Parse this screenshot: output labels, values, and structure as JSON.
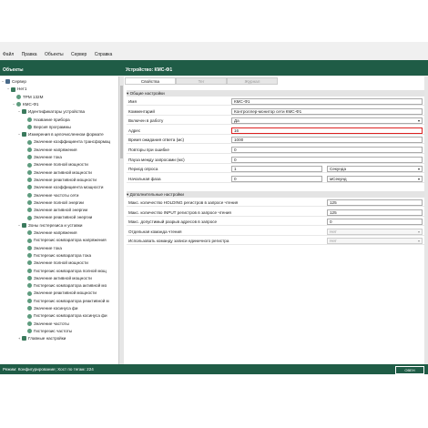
{
  "menu": [
    "Файл",
    "Правка",
    "Объекты",
    "Сервер",
    "Справка"
  ],
  "panels": {
    "left_title": "Объекты",
    "right_title": "Устройство: КМС-Ф1"
  },
  "tree": [
    {
      "label": "Сервер",
      "icon": "server-icon",
      "depth": 0,
      "expander": "−"
    },
    {
      "label": "Нет1",
      "icon": "folder-icon",
      "depth": 1,
      "expander": "−"
    },
    {
      "label": "ТРМ 132М",
      "icon": "device-icon",
      "depth": 2,
      "expander": ""
    },
    {
      "label": "КМС-Ф1",
      "icon": "device-icon",
      "depth": 2,
      "expander": "−"
    },
    {
      "label": "Идентификаторы устройства",
      "icon": "folder-icon",
      "depth": 3,
      "expander": "−"
    },
    {
      "label": "Название прибора",
      "icon": "param-icon",
      "depth": 4,
      "expander": ""
    },
    {
      "label": "Версия программы",
      "icon": "param-icon",
      "depth": 4,
      "expander": ""
    },
    {
      "label": "Измерения в целочисленном формате",
      "icon": "folder-icon",
      "depth": 3,
      "expander": "−"
    },
    {
      "label": "Значение коэффициента трансформац",
      "icon": "param-icon",
      "depth": 4,
      "expander": ""
    },
    {
      "label": "Значение напряжения",
      "icon": "param-icon",
      "depth": 4,
      "expander": ""
    },
    {
      "label": "Значение тока",
      "icon": "param-icon",
      "depth": 4,
      "expander": ""
    },
    {
      "label": "Значение полной мощности",
      "icon": "param-icon",
      "depth": 4,
      "expander": ""
    },
    {
      "label": "Значение активной мощности",
      "icon": "param-icon",
      "depth": 4,
      "expander": ""
    },
    {
      "label": "Значение реактивной мощности",
      "icon": "param-icon",
      "depth": 4,
      "expander": ""
    },
    {
      "label": "Значение коэффициента мощности",
      "icon": "param-icon",
      "depth": 4,
      "expander": ""
    },
    {
      "label": "Значение частоты сети",
      "icon": "param-icon",
      "depth": 4,
      "expander": ""
    },
    {
      "label": "Значение полной энергии",
      "icon": "param-icon",
      "depth": 4,
      "expander": ""
    },
    {
      "label": "Значение активной энергии",
      "icon": "param-icon",
      "depth": 4,
      "expander": ""
    },
    {
      "label": "Значение реактивной энергии",
      "icon": "param-icon",
      "depth": 4,
      "expander": ""
    },
    {
      "label": "Зоны гистерезиса и уставки",
      "icon": "folder-icon",
      "depth": 3,
      "expander": "−"
    },
    {
      "label": "Значение напряжения",
      "icon": "param-icon",
      "depth": 4,
      "expander": ""
    },
    {
      "label": "Гистерезис компаратора напряжения",
      "icon": "param-icon",
      "depth": 4,
      "expander": ""
    },
    {
      "label": "Значение тока",
      "icon": "param-icon",
      "depth": 4,
      "expander": ""
    },
    {
      "label": "Гистерезис компаратора тока",
      "icon": "param-icon",
      "depth": 4,
      "expander": ""
    },
    {
      "label": "Значение полной мощности",
      "icon": "param-icon",
      "depth": 4,
      "expander": ""
    },
    {
      "label": "Гистерезис компаратора полной мощ",
      "icon": "param-icon",
      "depth": 4,
      "expander": ""
    },
    {
      "label": "Значение активной мощности",
      "icon": "param-icon",
      "depth": 4,
      "expander": ""
    },
    {
      "label": "Гистерезис компаратора активной мо",
      "icon": "param-icon",
      "depth": 4,
      "expander": ""
    },
    {
      "label": "Значение реактивной мощности",
      "icon": "param-icon",
      "depth": 4,
      "expander": ""
    },
    {
      "label": "Гистерезис компаратора реактивной м",
      "icon": "param-icon",
      "depth": 4,
      "expander": ""
    },
    {
      "label": "Значение косинуса фи",
      "icon": "param-icon",
      "depth": 4,
      "expander": ""
    },
    {
      "label": "Гистерезис компаратора косинуса фи",
      "icon": "param-icon",
      "depth": 4,
      "expander": ""
    },
    {
      "label": "Значение частоты",
      "icon": "param-icon",
      "depth": 4,
      "expander": ""
    },
    {
      "label": "Гистерезис частоты",
      "icon": "param-icon",
      "depth": 4,
      "expander": ""
    },
    {
      "label": "Главные настройки",
      "icon": "folder-icon",
      "depth": 3,
      "expander": "+"
    }
  ],
  "tabs": [
    {
      "label": "Свойства",
      "active": true
    },
    {
      "label": "Тег",
      "active": false
    },
    {
      "label": "Журнал",
      "active": false
    }
  ],
  "sections": {
    "general": "Общие настройки",
    "extra": "Дополнительные настройки"
  },
  "general_rows": [
    {
      "label": "Имя",
      "value": "КМС-Ф1",
      "kind": "text"
    },
    {
      "label": "Комментарий",
      "value": "Контроллер-монитор сети КМС-Ф1",
      "kind": "text"
    },
    {
      "label": "Включен в работу",
      "value": "Да",
      "kind": "select"
    },
    {
      "label": "Адрес",
      "value": "16",
      "kind": "text-red"
    },
    {
      "label": "Время ожидания ответа (мс)",
      "value": "1000",
      "kind": "text"
    },
    {
      "label": "Повторы при ошибке",
      "value": "0",
      "kind": "text"
    },
    {
      "label": "Пауза между запросами (мс)",
      "value": "0",
      "kind": "text"
    },
    {
      "label": "Период опроса",
      "value": "1",
      "unit": "Секунда",
      "kind": "split"
    },
    {
      "label": "Начальная фаза",
      "value": "0",
      "unit": "мСекунд",
      "kind": "split"
    }
  ],
  "extra_rows": [
    {
      "label": "Макс. количество HOLDING регистров в запросе чтения",
      "value": "125",
      "kind": "text"
    },
    {
      "label": "Макс. количество INPUT регистров в запросе чтения",
      "value": "125",
      "kind": "text"
    },
    {
      "label": "Макс. допустимый разрыв адресов в запросе",
      "value": "0",
      "kind": "text"
    },
    {
      "label": "Отдельная команда чтения",
      "value": "Нет",
      "kind": "select-dis"
    },
    {
      "label": "Использовать команду записи единичного регистра",
      "value": "Нет",
      "kind": "select-dis"
    }
  ],
  "status": {
    "text": "Режим: Конфигурирование; Хост по тегам: 224",
    "logo": "ОВЕН"
  },
  "colors": {
    "accent": "#1f5c46",
    "highlight": "#d22222"
  }
}
